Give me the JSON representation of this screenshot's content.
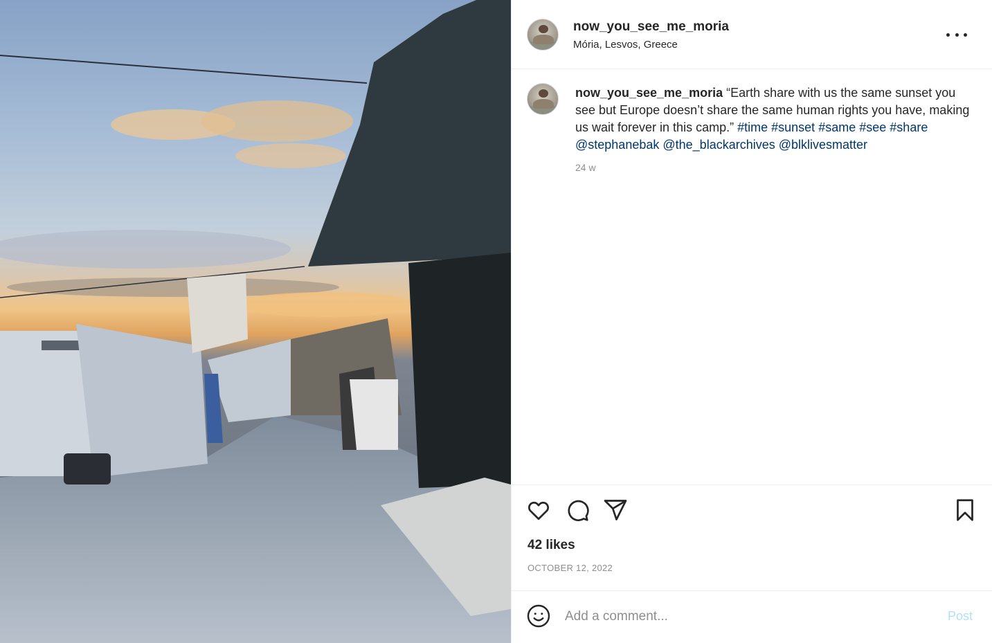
{
  "header": {
    "username": "now_you_see_me_moria",
    "location": "Mória, Lesvos, Greece",
    "more_icon": "more-horizontal-icon"
  },
  "caption": {
    "username": "now_you_see_me_moria",
    "text": "“Earth share with us the same sunset you see but Europe doesn’t share the same human rights you have, making us wait forever in this camp.”",
    "tags": [
      "#time",
      "#sunset",
      "#same",
      "#see",
      "#share",
      "@stephanebak",
      "@the_blackarchives",
      "@blklivesmatter"
    ],
    "time_ago": "24 w"
  },
  "actions": {
    "icons": [
      "heart-icon",
      "comment-icon",
      "share-icon",
      "bookmark-icon"
    ],
    "likes": "42 likes",
    "date": "OCTOBER 12, 2022"
  },
  "comment_box": {
    "placeholder": "Add a comment...",
    "post_label": "Post",
    "emoji_icon": "emoji-icon"
  },
  "colors": {
    "link": "#00376b",
    "muted": "#8e8e8e",
    "post_disabled": "#b2dffc",
    "border": "#efefef"
  }
}
